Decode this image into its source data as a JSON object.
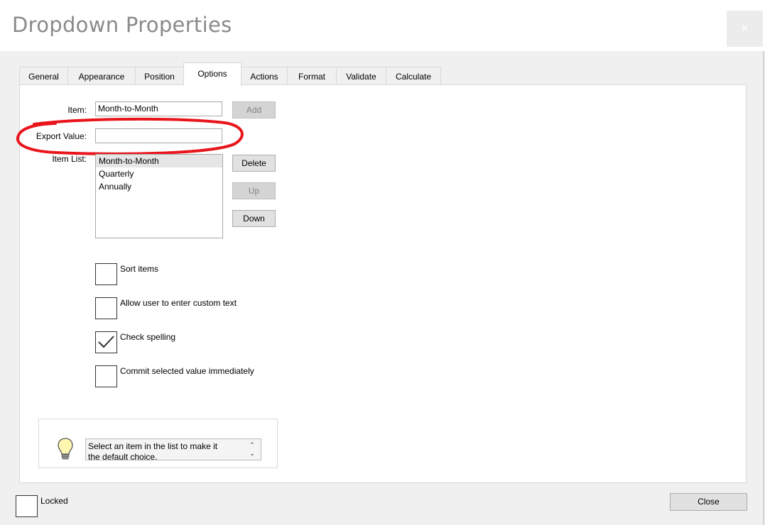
{
  "window": {
    "title": "Dropdown Properties",
    "close_glyph": "×"
  },
  "tabs": [
    {
      "label": "General"
    },
    {
      "label": "Appearance"
    },
    {
      "label": "Position"
    },
    {
      "label": "Options"
    },
    {
      "label": "Actions"
    },
    {
      "label": "Format"
    },
    {
      "label": "Validate"
    },
    {
      "label": "Calculate"
    }
  ],
  "active_tab": "Options",
  "options": {
    "item_label": "Item:",
    "item_value": "Month-to-Month",
    "add_label": "Add",
    "export_label": "Export Value:",
    "export_value": "",
    "item_list_label": "Item List:",
    "items": [
      "Month-to-Month",
      "Quarterly",
      "Annually"
    ],
    "selected_item": "Month-to-Month",
    "delete_label": "Delete",
    "up_label": "Up",
    "down_label": "Down",
    "checkboxes": [
      {
        "label": "Sort items",
        "checked": false
      },
      {
        "label": "Allow user to enter custom text",
        "checked": false
      },
      {
        "label": "Check spelling",
        "checked": true
      },
      {
        "label": "Commit selected value immediately",
        "checked": false
      }
    ],
    "hint_text": "Select an item in the list to make it the default choice."
  },
  "footer": {
    "locked_label": "Locked",
    "locked_checked": false,
    "close_label": "Close"
  },
  "annotation": {
    "color": "#e8151b",
    "shape": "ellipse"
  },
  "icons": {
    "hint": "lightbulb-icon",
    "check": "check-icon"
  }
}
